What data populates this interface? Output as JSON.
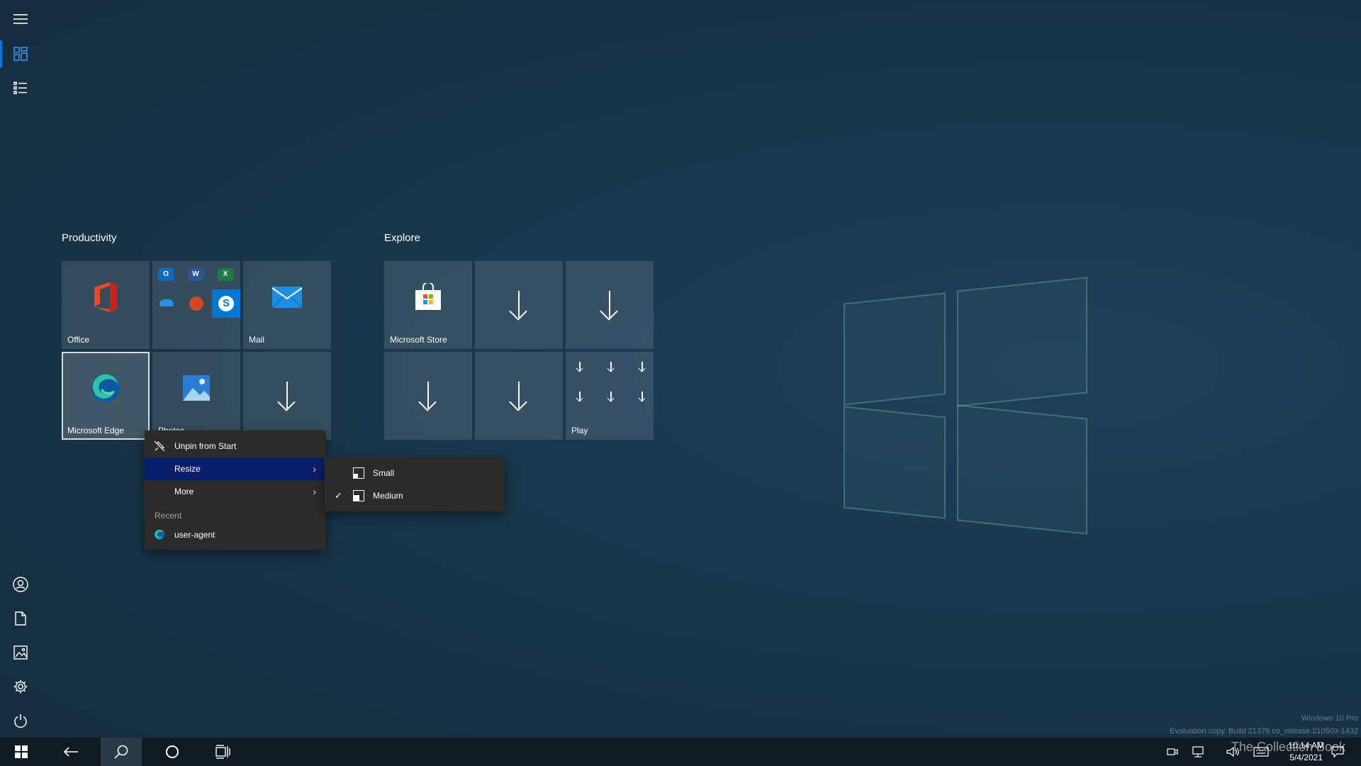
{
  "rail": {
    "top": [
      "hamburger-icon",
      "tiles-icon",
      "list-icon"
    ],
    "bottom": [
      "user-icon",
      "document-icon",
      "pictures-icon",
      "gear-icon",
      "power-icon"
    ]
  },
  "groups": {
    "productivity": {
      "title": "Productivity",
      "office_label": "Office",
      "mail_label": "Mail",
      "edge_label": "Microsoft Edge",
      "photos_label": "Photos"
    },
    "explore": {
      "title": "Explore",
      "store_label": "Microsoft Store",
      "play_label": "Play"
    }
  },
  "context_menu": {
    "unpin": "Unpin from Start",
    "resize": "Resize",
    "more": "More",
    "recent_heading": "Recent",
    "recent_item": "user-agent"
  },
  "resize_menu": {
    "small": "Small",
    "medium": "Medium",
    "selected": "Medium"
  },
  "taskbar": {
    "time": "10:14 AM",
    "date": "5/4/2021"
  },
  "watermark": {
    "edition": "Windows 10 Pro",
    "build": "Evaluation copy. Build 21376.co_release.210503-1432",
    "overlay": "The Collection Book"
  },
  "colors": {
    "accent": "#0078d4",
    "menu_highlight": "#0b1e6b",
    "menu_bg": "#2b2b2b",
    "taskbar_bg": "#101a22"
  }
}
